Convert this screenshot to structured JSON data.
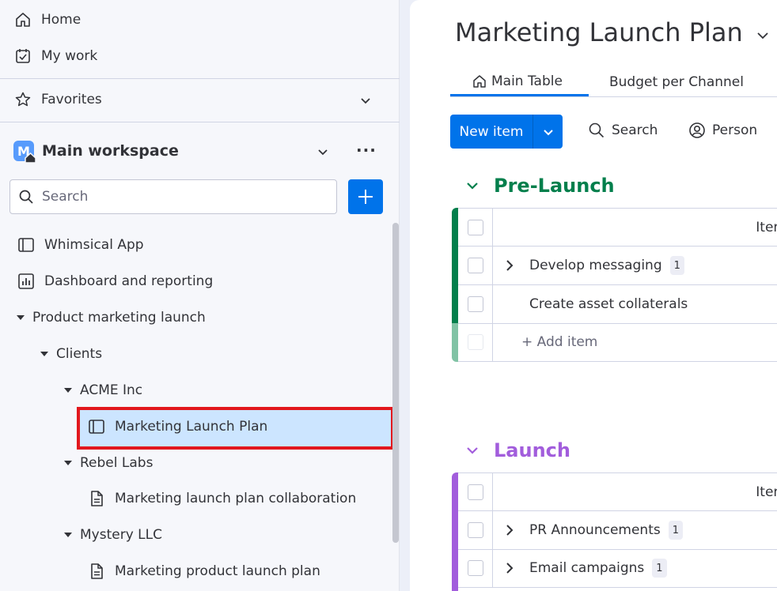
{
  "sidebar": {
    "home": "Home",
    "my_work": "My work",
    "favorites": "Favorites",
    "workspace": {
      "logo": "M",
      "title": "Main workspace",
      "more": "···"
    },
    "search_placeholder": "Search",
    "tree": {
      "whimsical": "Whimsical App",
      "dashboard": "Dashboard and reporting",
      "product_launch": "Product marketing launch",
      "clients": "Clients",
      "acme": "ACME Inc",
      "marketing_launch_plan": "Marketing Launch Plan",
      "rebel": "Rebel Labs",
      "collab": "Marketing launch plan collaboration",
      "mystery": "Mystery LLC",
      "product_plan": "Marketing product launch plan"
    }
  },
  "main": {
    "title": "Marketing Launch Plan",
    "tabs": [
      {
        "label": "Main Table"
      },
      {
        "label": "Budget per Channel"
      }
    ],
    "toolbar": {
      "new_item": "New item",
      "search": "Search",
      "person": "Person"
    },
    "groups": [
      {
        "title": "Pre-Launch",
        "color": "#037f4c",
        "header": "Item",
        "rows": [
          {
            "name": "Develop messaging",
            "subitems": "1"
          },
          {
            "name": "Create asset collaterals"
          }
        ],
        "add_item": "+ Add item"
      },
      {
        "title": "Launch",
        "color": "#a25ddc",
        "header": "Item",
        "rows": [
          {
            "name": "PR Announcements",
            "subitems": "1"
          },
          {
            "name": "Email campaigns",
            "subitems": "1"
          }
        ]
      }
    ]
  }
}
